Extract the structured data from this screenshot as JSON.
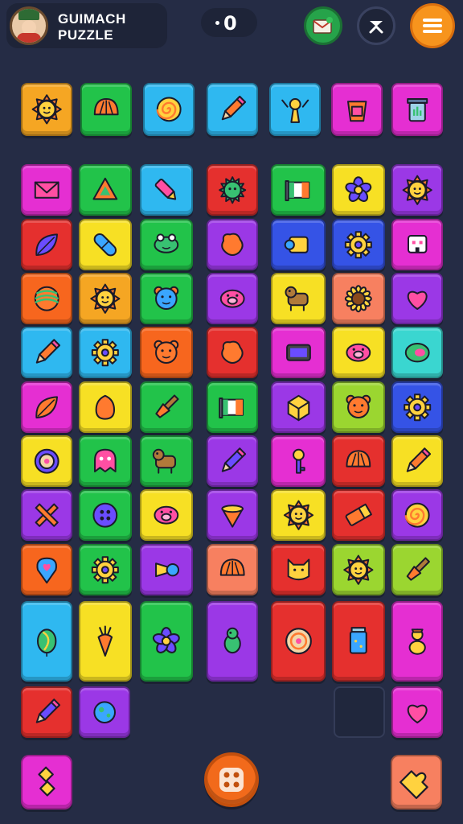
{
  "header": {
    "title_line1": "GUIMACH",
    "title_line2": "PUZZLE",
    "score": "0"
  },
  "colors": {
    "background": "#252c45",
    "orange": "#f5a623",
    "green": "#22c34a",
    "cyan": "#2fb8f0",
    "magenta": "#e52fd2",
    "purple": "#9b38e6",
    "red": "#e5302e",
    "yellow": "#f7e024",
    "lime": "#9bd630",
    "bright_orange": "#f7661e",
    "blue": "#3553e6",
    "teal": "#3ad6d0",
    "salmon": "#f78060"
  },
  "top_row": [
    {
      "color": "#f5a623",
      "icon": "sun-icon"
    },
    {
      "color": "#22c34a",
      "icon": "shell-icon"
    },
    {
      "color": "#2fb8f0",
      "icon": "spiral-icon"
    },
    {
      "color": "#2fb8f0",
      "icon": "pencil-icon"
    },
    {
      "color": "#2fb8f0",
      "icon": "fairy-icon"
    },
    {
      "color": "#e52fd2",
      "icon": "bucket-icon"
    },
    {
      "color": "#e52fd2",
      "icon": "trash-can-icon"
    }
  ],
  "grid": [
    [
      {
        "color": "#e52fd2",
        "icon": "envelope-icon"
      },
      {
        "color": "#22c34a",
        "icon": "triangle-icon"
      },
      {
        "color": "#2fb8f0",
        "icon": "crayon-icon"
      },
      {
        "color": "#e5302e",
        "icon": "virus-icon"
      },
      {
        "color": "#22c34a",
        "icon": "flag-icon"
      },
      {
        "color": "#f7e024",
        "icon": "flower-icon"
      },
      {
        "color": "#9b38e6",
        "icon": "sun-icon"
      }
    ],
    [
      {
        "color": "#e5302e",
        "icon": "feather-icon"
      },
      {
        "color": "#f7e024",
        "icon": "capsule-icon"
      },
      {
        "color": "#22c34a",
        "icon": "frog-icon"
      },
      {
        "color": "#9b38e6",
        "icon": "blob-icon"
      },
      {
        "color": "#3553e6",
        "icon": "scroll-icon"
      },
      {
        "color": "#3553e6",
        "icon": "gear-icon"
      },
      {
        "color": "#e52fd2",
        "icon": "robot-icon"
      }
    ],
    [
      {
        "color": "#f7661e",
        "icon": "ball-icon"
      },
      {
        "color": "#f5a623",
        "icon": "sun-face-icon"
      },
      {
        "color": "#22c34a",
        "icon": "teddy-bear-icon"
      },
      {
        "color": "#9b38e6",
        "icon": "pig-icon"
      },
      {
        "color": "#f7e024",
        "icon": "dog-icon"
      },
      {
        "color": "#f78060",
        "icon": "sunflower-icon"
      },
      {
        "color": "#9b38e6",
        "icon": "heart-icon"
      }
    ],
    [
      {
        "color": "#2fb8f0",
        "icon": "pencil-icon"
      },
      {
        "color": "#2fb8f0",
        "icon": "gear-icon"
      },
      {
        "color": "#f7661e",
        "icon": "bear-face-icon"
      },
      {
        "color": "#e5302e",
        "icon": "blob-icon"
      },
      {
        "color": "#e52fd2",
        "icon": "tablet-icon"
      },
      {
        "color": "#f7e024",
        "icon": "pig-icon"
      },
      {
        "color": "#3ad6d0",
        "icon": "candy-icon"
      }
    ],
    [
      {
        "color": "#e52fd2",
        "icon": "leaf-icon"
      },
      {
        "color": "#f7e024",
        "icon": "egg-icon"
      },
      {
        "color": "#22c34a",
        "icon": "brush-icon"
      },
      {
        "color": "#22c34a",
        "icon": "flag-icon"
      },
      {
        "color": "#9b38e6",
        "icon": "cube-icon"
      },
      {
        "color": "#9bd630",
        "icon": "box-face-icon"
      },
      {
        "color": "#3553e6",
        "icon": "gear-icon"
      }
    ],
    [
      {
        "color": "#f7e024",
        "icon": "target-icon"
      },
      {
        "color": "#22c34a",
        "icon": "ghost-icon"
      },
      {
        "color": "#22c34a",
        "icon": "dog-icon"
      },
      {
        "color": "#9b38e6",
        "icon": "marker-icon"
      },
      {
        "color": "#e52fd2",
        "icon": "key-icon"
      },
      {
        "color": "#e5302e",
        "icon": "shell-icon"
      },
      {
        "color": "#f7e024",
        "icon": "pencil-icon"
      }
    ],
    [
      {
        "color": "#9b38e6",
        "icon": "cross-icon"
      },
      {
        "color": "#22c34a",
        "icon": "button-icon"
      },
      {
        "color": "#f7e024",
        "icon": "pig-icon"
      },
      {
        "color": "#9b38e6",
        "icon": "cone-icon"
      },
      {
        "color": "#f7e024",
        "icon": "sun-icon"
      },
      {
        "color": "#e5302e",
        "icon": "eraser-icon"
      },
      {
        "color": "#9b38e6",
        "icon": "spiral-icon"
      }
    ],
    [
      {
        "color": "#f7661e",
        "icon": "location-pin-icon"
      },
      {
        "color": "#22c34a",
        "icon": "gear-icon"
      },
      {
        "color": "#9b38e6",
        "icon": "horn-icon"
      },
      {
        "color": "#f78060",
        "icon": "shell-icon"
      },
      {
        "color": "#e5302e",
        "icon": "cat-face-icon"
      },
      {
        "color": "#9bd630",
        "icon": "sun-icon"
      },
      {
        "color": "#9bd630",
        "icon": "brush-icon"
      }
    ],
    [
      {
        "color": "#2fb8f0",
        "icon": "balloon-icon"
      },
      {
        "color": "#f7e024",
        "icon": "carrot-icon"
      },
      {
        "color": "#22c34a",
        "icon": "flower-icon"
      },
      {
        "color": "#9b38e6",
        "icon": "dragon-icon"
      },
      {
        "color": "#e5302e",
        "icon": "mask-icon"
      },
      {
        "color": "#e5302e",
        "icon": "jar-icon"
      },
      {
        "color": "#e52fd2",
        "icon": "doll-icon"
      }
    ]
  ],
  "last_row": [
    {
      "color": "#e5302e",
      "icon": "marker-icon"
    },
    {
      "color": "#9b38e6",
      "icon": "planet-icon"
    },
    {
      "color": "#2a3149",
      "icon": "empty-slot"
    },
    {
      "color": "#e52fd2",
      "icon": "heart-icon"
    }
  ],
  "bottom_buttons": {
    "left": {
      "color": "#e52fd2",
      "icon": "diamonds-icon"
    },
    "center": {
      "color": "#f26a1b",
      "icon": "dice-icon"
    },
    "right": {
      "color": "#f78060",
      "icon": "puzzle-icon"
    }
  }
}
